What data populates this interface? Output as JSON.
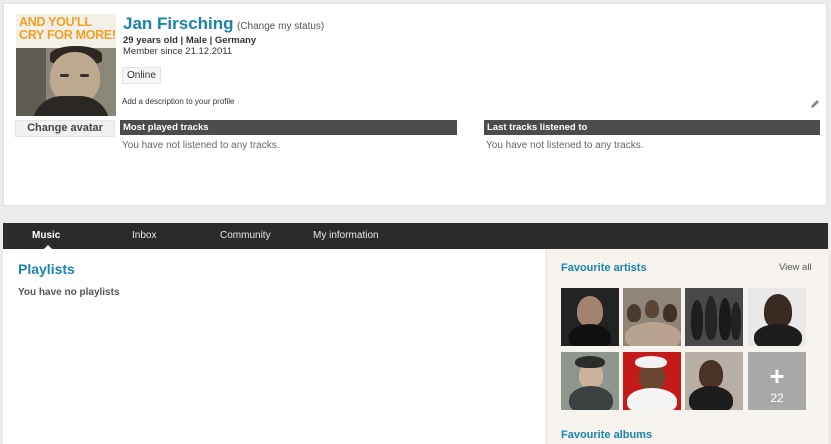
{
  "profile": {
    "avatar_text": "AND YOU'LL CRY FOR MORE!",
    "name": "Jan Firsching",
    "change_status": "(Change my status)",
    "details": "29 years old | Male | Germany",
    "member_since": "Member since 21.12.2011",
    "status": "Online",
    "description_prompt": "Add a description to your profile",
    "change_avatar": "Change avatar"
  },
  "most_played": {
    "title": "Most played tracks",
    "empty": "You have not listened to any tracks."
  },
  "last_tracks": {
    "title": "Last tracks listened to",
    "empty": "You have not listened to any tracks."
  },
  "tabs": [
    {
      "label": "Music",
      "active": true
    },
    {
      "label": "Inbox",
      "active": false
    },
    {
      "label": "Community",
      "active": false
    },
    {
      "label": "My information",
      "active": false
    }
  ],
  "playlists": {
    "title": "Playlists",
    "empty": "You have no playlists"
  },
  "favourite_artists": {
    "title": "Favourite artists",
    "view_all": "View all",
    "more_count": "22",
    "more_icon": "plus-icon"
  },
  "favourite_albums": {
    "title": "Favourite albums"
  },
  "colors": {
    "accent": "#1a84ad",
    "tabbar": "#2b2b2b",
    "panel_head": "#4c4c4c"
  }
}
